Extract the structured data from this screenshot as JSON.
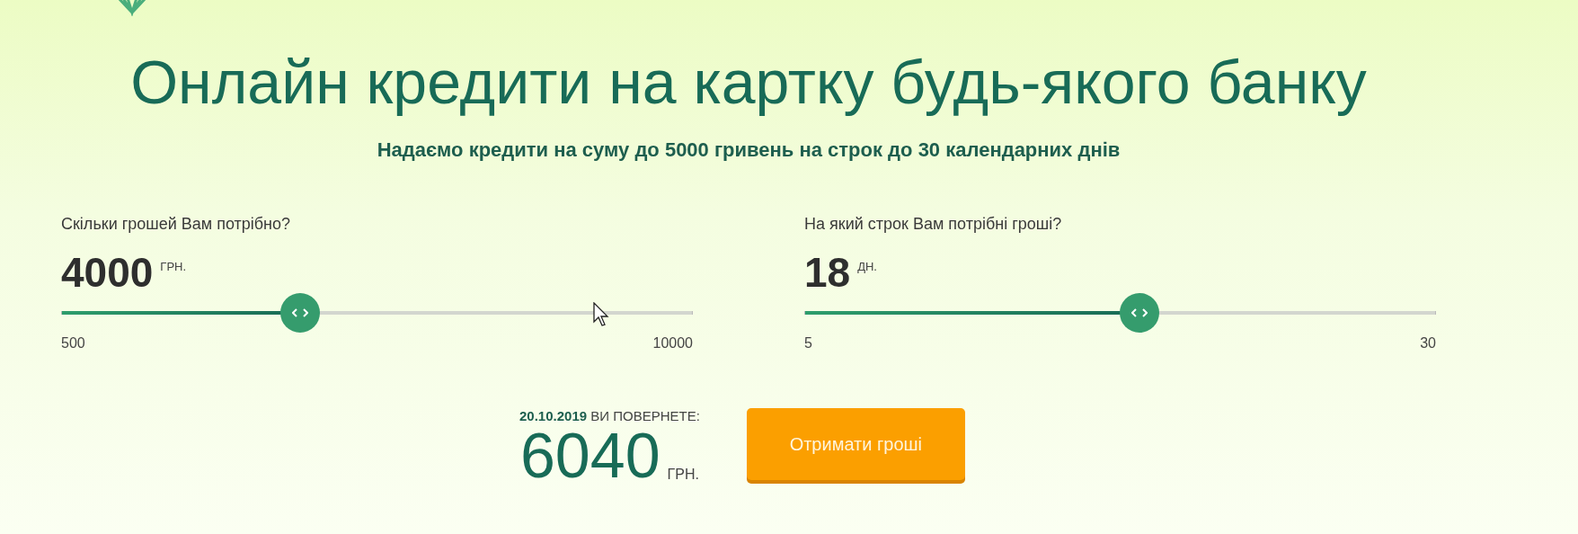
{
  "title": "Онлайн кредити на картку будь-якого банку",
  "subtitle": "Надаємо кредити на суму до 5000 гривень на строк до 30 календарних днів",
  "sliders": [
    {
      "label": "Скільки грошей Вам потрібно?",
      "value": "4000",
      "unit": "ГРН.",
      "level": 0.378,
      "min_label": "500",
      "max_label": "10000"
    },
    {
      "label": "На який строк Вам потрібні гроші?",
      "value": "18",
      "unit": "ДН.",
      "level": 0.53,
      "min_label": "5",
      "max_label": "30"
    }
  ],
  "summary": {
    "date": "20.10.2019",
    "caption": "ВИ ПОВЕРНЕТЕ:",
    "amount": "6040",
    "unit": "ГРН."
  },
  "button": {
    "label": "Отримати гроші"
  }
}
